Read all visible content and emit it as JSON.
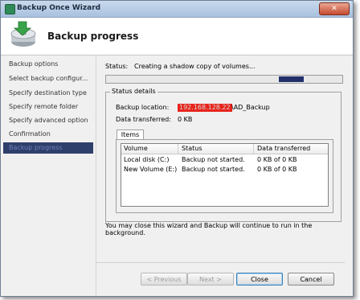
{
  "window": {
    "title": "Backup Once Wizard",
    "close_glyph": "✕"
  },
  "header": {
    "title": "Backup progress",
    "icon": "backup-wizard-icon"
  },
  "nav": {
    "items": [
      {
        "label": "Backup options"
      },
      {
        "label": "Select backup configur..."
      },
      {
        "label": "Specify destination type"
      },
      {
        "label": "Specify remote folder"
      },
      {
        "label": "Specify advanced option"
      },
      {
        "label": "Confirmation"
      },
      {
        "label": "Backup progress"
      }
    ]
  },
  "status": {
    "label": "Status:",
    "text": "Creating a shadow copy of volumes...",
    "progress_marquee": true
  },
  "details": {
    "group_title": "Status details",
    "location_label": "Backup location:",
    "location_ip_redacted": "192.168.128.22",
    "location_path": "\\AD_Backup",
    "transferred_label": "Data transferred:",
    "transferred_value": "0 KB"
  },
  "tabs": {
    "items_label": "Items"
  },
  "table": {
    "columns": [
      "Volume",
      "Status",
      "Data transferred"
    ],
    "rows": [
      {
        "volume": "Local disk (C:)",
        "status": "Backup not started.",
        "transferred": "0 KB of 0 KB"
      },
      {
        "volume": "New Volume (E:)",
        "status": "Backup not started.",
        "transferred": "0 KB of 0 KB"
      }
    ]
  },
  "info_text": "You may close this wizard and Backup will continue to run in the background.",
  "buttons": {
    "previous": "< Previous",
    "next": "Next >",
    "close": "Close",
    "cancel": "Cancel"
  },
  "colors": {
    "active_nav": "#2f3f6b",
    "progress": "#22306a",
    "redaction": "#e8241b"
  }
}
